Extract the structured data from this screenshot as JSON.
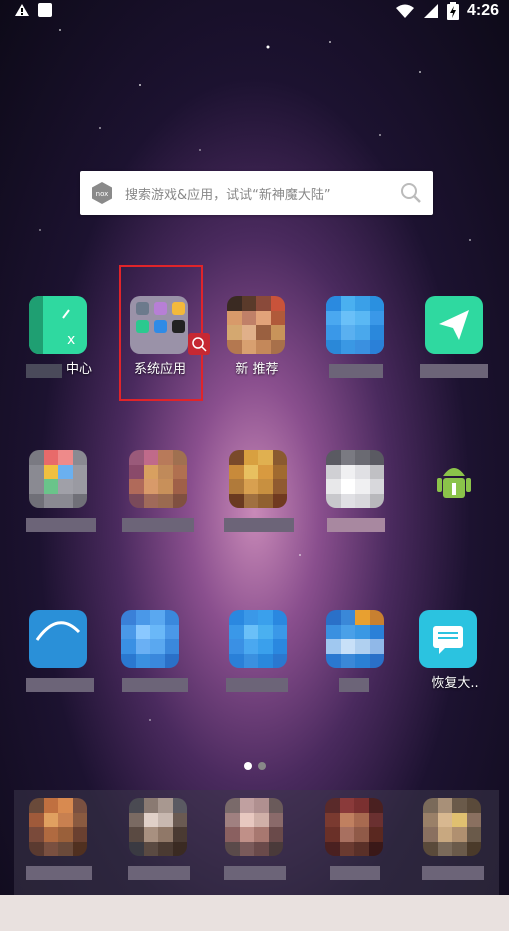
{
  "status_bar": {
    "time": "4:26",
    "icons": [
      "warning-icon",
      "notification-square-icon",
      "wifi-icon",
      "signal-icon",
      "battery-charging-icon"
    ]
  },
  "search": {
    "brand": "nox",
    "placeholder": "搜索游戏&应用，试试“新神魔大陆”"
  },
  "apps_row1": [
    {
      "label": "中心",
      "color": "#2fd9a0"
    },
    {
      "label": "系统应用",
      "color": "#9a92a8",
      "highlighted": true
    },
    {
      "label": "新 推荐",
      "color": "#c56a4a"
    },
    {
      "label": "",
      "color": "#3aa0e8"
    },
    {
      "label": "",
      "color": "#2fd9a0"
    }
  ],
  "apps_row3_last_label": "恢复大..",
  "colors": {
    "highlight_border": "#e0242a",
    "page_dot_active": "#ffffff",
    "page_dot_inactive": "#888888"
  }
}
